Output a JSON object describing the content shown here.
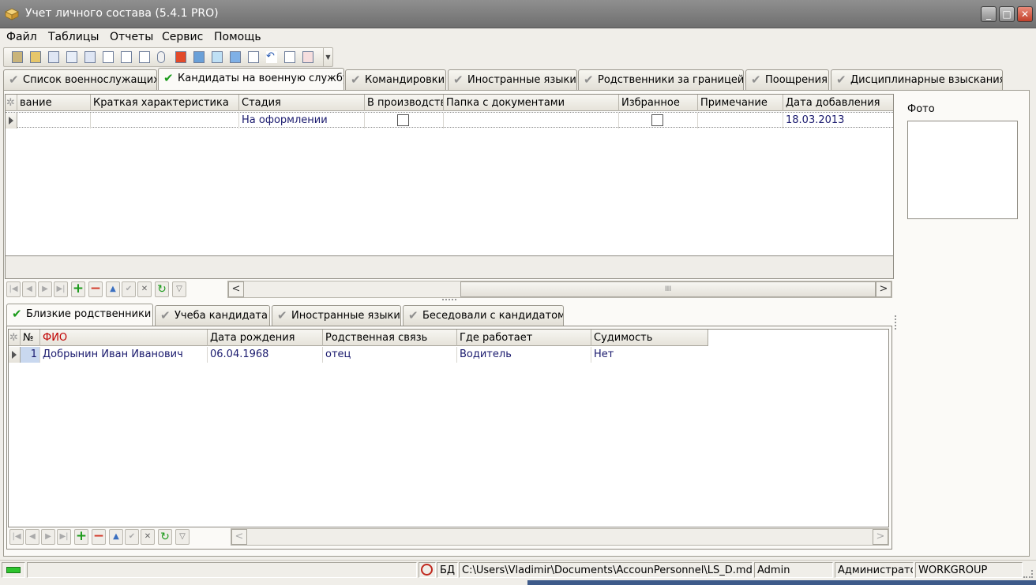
{
  "window": {
    "title": "Учет личного состава (5.4.1 PRO)",
    "minimize": "_",
    "maximize": "□",
    "close": "✕"
  },
  "menu": [
    "Файл",
    "Таблицы",
    "Отчеты",
    "Сервис",
    "Помощь"
  ],
  "main_tabs": [
    {
      "label": "Список военнослужащих",
      "active": false
    },
    {
      "label": "Кандидаты на военную службу",
      "active": true
    },
    {
      "label": "Командировки",
      "active": false
    },
    {
      "label": "Иностранные языки",
      "active": false
    },
    {
      "label": "Родственники за границей",
      "active": false
    },
    {
      "label": "Поощрения",
      "active": false
    },
    {
      "label": "Дисциплинарные взыскания",
      "active": false
    }
  ],
  "top_grid": {
    "columns": [
      "вание",
      "Краткая характеристика",
      "Стадия",
      "В производстве",
      "Папка с документами",
      "Избранное",
      "Примечание",
      "Дата добавления"
    ],
    "rows": [
      {
        "name": "",
        "characteristic": "",
        "stage": "На оформлении",
        "in_production": false,
        "folder": "",
        "favorite": false,
        "note": "",
        "date_added": "18.03.2013"
      }
    ]
  },
  "photo": {
    "label": "Фото"
  },
  "sub_tabs": [
    {
      "label": "Близкие родственники",
      "active": true
    },
    {
      "label": "Учеба кандидата",
      "active": false
    },
    {
      "label": "Иностранные языки",
      "active": false
    },
    {
      "label": "Беседовали с кандидатом",
      "active": false
    }
  ],
  "relatives_grid": {
    "columns": [
      "№",
      "ФИО",
      "Дата рождения",
      "Родственная связь",
      "Где работает",
      "Судимость"
    ],
    "rows": [
      {
        "num": "1",
        "fio": "Добрынин Иван Иванович",
        "birth": "06.04.1968",
        "relation": "отец",
        "work": "Водитель",
        "record": "Нет"
      }
    ]
  },
  "nav_buttons": [
    "first-icon",
    "prior-icon",
    "next-icon",
    "last-icon",
    "add-icon",
    "delete-icon",
    "edit-icon",
    "post-icon",
    "cancel-icon",
    "refresh-icon",
    "filter-icon"
  ],
  "scroll": {
    "left": "<",
    "right": ">",
    "thumb": "III"
  },
  "status": {
    "db_label": "БД",
    "db_path": "C:\\Users\\Vladimir\\Documents\\AccounPersonnel\\LS_D.mdb",
    "user": "Admin",
    "role": "Администрато",
    "group": "WORKGROUP"
  },
  "colors": {
    "accent_green": "#1a9a1a",
    "fio_header": "#c00000",
    "row_text": "#1a1a6e"
  }
}
